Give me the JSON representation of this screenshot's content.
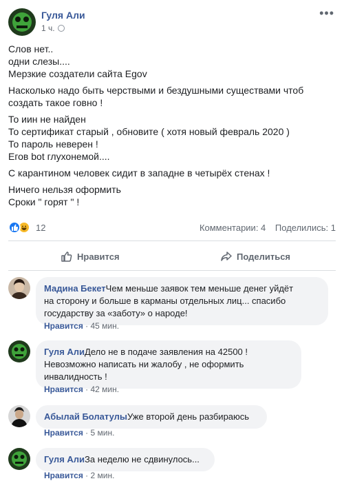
{
  "post": {
    "author": "Гуля Али",
    "time": "1 ч.",
    "more_icon": "more-dots-icon",
    "paragraphs": [
      [
        "Слов нет..",
        "одни слезы....",
        "Мерзкие создатели сайта Egov"
      ],
      [
        "Насколько надо быть черствыми и бездушными существами чтоб",
        "создать такое говно !"
      ],
      [
        "То иин не найден",
        "То сертификат старый , обновите ( хотя новый февраль 2020 )",
        "То пароль неверен !",
        "Егов bot глухонемой...."
      ],
      [
        "С карантином человек сидит в западне в четырёх стенах !"
      ],
      [
        "Ничего нельзя оформить",
        "Сроки \" горят \" !"
      ]
    ]
  },
  "stats": {
    "reactions_count": "12",
    "comments": "Комментарии: 4",
    "shares": "Поделились: 1"
  },
  "actions": {
    "like": "Нравится",
    "share": "Поделиться"
  },
  "comments": [
    {
      "name": "Мадина Бекет",
      "lines": [
        "Чем меньше заявок тем меньше денег уйдёт",
        "на сторону и больше в карманы отдельных лиц... спасибо",
        "государству за «заботу» о народе!"
      ],
      "like": "Нравится",
      "sep": " · ",
      "time": "45 мин."
    },
    {
      "name": "Гуля Али",
      "lines": [
        "Дело не в подаче заявления на 42500 !",
        "Невозможно написать ни жалобу , не оформить",
        "инвалидность !"
      ],
      "like": "Нравится",
      "sep": " · ",
      "time": "42 мин."
    },
    {
      "name": "Абылай Болатулы",
      "lines": [
        "Уже второй день разбираюсь"
      ],
      "like": "Нравится",
      "sep": " · ",
      "time": "5 мин."
    },
    {
      "name": "Гуля Али",
      "lines": [
        "За неделю не сдвинулось..."
      ],
      "like": "Нравится",
      "sep": " · ",
      "time": "2 мин."
    }
  ],
  "colors": {
    "link": "#385898",
    "bubble": "#f2f3f5",
    "like_blue": "#1877f2",
    "haha_yellow": "#f7b928"
  }
}
